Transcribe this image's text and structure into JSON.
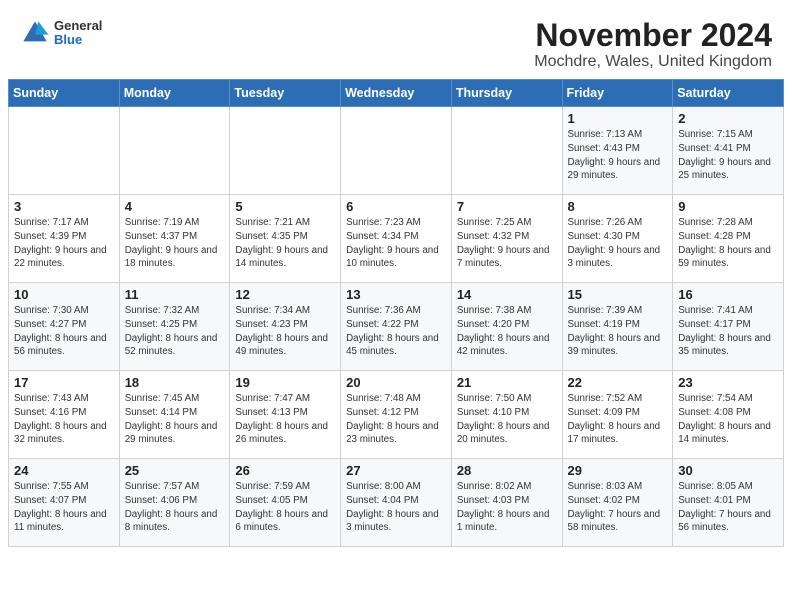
{
  "header": {
    "title": "November 2024",
    "subtitle": "Mochdre, Wales, United Kingdom",
    "logo_general": "General",
    "logo_blue": "Blue"
  },
  "weekdays": [
    "Sunday",
    "Monday",
    "Tuesday",
    "Wednesday",
    "Thursday",
    "Friday",
    "Saturday"
  ],
  "weeks": [
    [
      {
        "day": "",
        "info": ""
      },
      {
        "day": "",
        "info": ""
      },
      {
        "day": "",
        "info": ""
      },
      {
        "day": "",
        "info": ""
      },
      {
        "day": "",
        "info": ""
      },
      {
        "day": "1",
        "info": "Sunrise: 7:13 AM\nSunset: 4:43 PM\nDaylight: 9 hours and 29 minutes."
      },
      {
        "day": "2",
        "info": "Sunrise: 7:15 AM\nSunset: 4:41 PM\nDaylight: 9 hours and 25 minutes."
      }
    ],
    [
      {
        "day": "3",
        "info": "Sunrise: 7:17 AM\nSunset: 4:39 PM\nDaylight: 9 hours and 22 minutes."
      },
      {
        "day": "4",
        "info": "Sunrise: 7:19 AM\nSunset: 4:37 PM\nDaylight: 9 hours and 18 minutes."
      },
      {
        "day": "5",
        "info": "Sunrise: 7:21 AM\nSunset: 4:35 PM\nDaylight: 9 hours and 14 minutes."
      },
      {
        "day": "6",
        "info": "Sunrise: 7:23 AM\nSunset: 4:34 PM\nDaylight: 9 hours and 10 minutes."
      },
      {
        "day": "7",
        "info": "Sunrise: 7:25 AM\nSunset: 4:32 PM\nDaylight: 9 hours and 7 minutes."
      },
      {
        "day": "8",
        "info": "Sunrise: 7:26 AM\nSunset: 4:30 PM\nDaylight: 9 hours and 3 minutes."
      },
      {
        "day": "9",
        "info": "Sunrise: 7:28 AM\nSunset: 4:28 PM\nDaylight: 8 hours and 59 minutes."
      }
    ],
    [
      {
        "day": "10",
        "info": "Sunrise: 7:30 AM\nSunset: 4:27 PM\nDaylight: 8 hours and 56 minutes."
      },
      {
        "day": "11",
        "info": "Sunrise: 7:32 AM\nSunset: 4:25 PM\nDaylight: 8 hours and 52 minutes."
      },
      {
        "day": "12",
        "info": "Sunrise: 7:34 AM\nSunset: 4:23 PM\nDaylight: 8 hours and 49 minutes."
      },
      {
        "day": "13",
        "info": "Sunrise: 7:36 AM\nSunset: 4:22 PM\nDaylight: 8 hours and 45 minutes."
      },
      {
        "day": "14",
        "info": "Sunrise: 7:38 AM\nSunset: 4:20 PM\nDaylight: 8 hours and 42 minutes."
      },
      {
        "day": "15",
        "info": "Sunrise: 7:39 AM\nSunset: 4:19 PM\nDaylight: 8 hours and 39 minutes."
      },
      {
        "day": "16",
        "info": "Sunrise: 7:41 AM\nSunset: 4:17 PM\nDaylight: 8 hours and 35 minutes."
      }
    ],
    [
      {
        "day": "17",
        "info": "Sunrise: 7:43 AM\nSunset: 4:16 PM\nDaylight: 8 hours and 32 minutes."
      },
      {
        "day": "18",
        "info": "Sunrise: 7:45 AM\nSunset: 4:14 PM\nDaylight: 8 hours and 29 minutes."
      },
      {
        "day": "19",
        "info": "Sunrise: 7:47 AM\nSunset: 4:13 PM\nDaylight: 8 hours and 26 minutes."
      },
      {
        "day": "20",
        "info": "Sunrise: 7:48 AM\nSunset: 4:12 PM\nDaylight: 8 hours and 23 minutes."
      },
      {
        "day": "21",
        "info": "Sunrise: 7:50 AM\nSunset: 4:10 PM\nDaylight: 8 hours and 20 minutes."
      },
      {
        "day": "22",
        "info": "Sunrise: 7:52 AM\nSunset: 4:09 PM\nDaylight: 8 hours and 17 minutes."
      },
      {
        "day": "23",
        "info": "Sunrise: 7:54 AM\nSunset: 4:08 PM\nDaylight: 8 hours and 14 minutes."
      }
    ],
    [
      {
        "day": "24",
        "info": "Sunrise: 7:55 AM\nSunset: 4:07 PM\nDaylight: 8 hours and 11 minutes."
      },
      {
        "day": "25",
        "info": "Sunrise: 7:57 AM\nSunset: 4:06 PM\nDaylight: 8 hours and 8 minutes."
      },
      {
        "day": "26",
        "info": "Sunrise: 7:59 AM\nSunset: 4:05 PM\nDaylight: 8 hours and 6 minutes."
      },
      {
        "day": "27",
        "info": "Sunrise: 8:00 AM\nSunset: 4:04 PM\nDaylight: 8 hours and 3 minutes."
      },
      {
        "day": "28",
        "info": "Sunrise: 8:02 AM\nSunset: 4:03 PM\nDaylight: 8 hours and 1 minute."
      },
      {
        "day": "29",
        "info": "Sunrise: 8:03 AM\nSunset: 4:02 PM\nDaylight: 7 hours and 58 minutes."
      },
      {
        "day": "30",
        "info": "Sunrise: 8:05 AM\nSunset: 4:01 PM\nDaylight: 7 hours and 56 minutes."
      }
    ]
  ]
}
